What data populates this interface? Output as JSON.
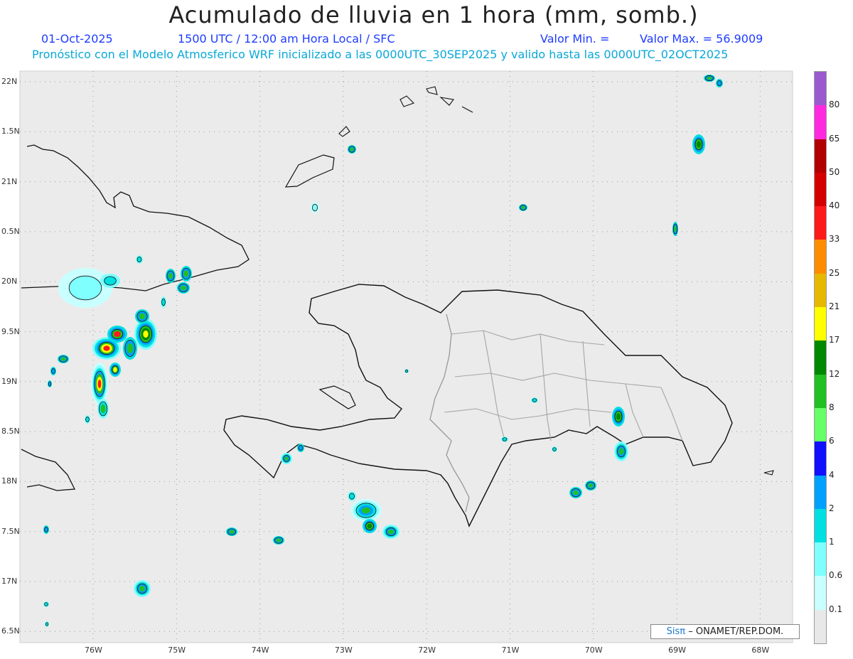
{
  "title": "Acumulado de lluvia en 1 hora (mm, somb.)",
  "header": {
    "date": "01-Oct-2025",
    "time": "1500 UTC / 12:00 am Hora Local / SFC",
    "min": "Valor Min. =",
    "max": "Valor Max. = 56.9009",
    "model": "Pronóstico con el Modelo Atmosferico WRF inicializado a las 0000UTC_30SEP2025 y valido hasta las  0000UTC_02OCT2025"
  },
  "lat_labels": [
    "22N",
    "1.5N",
    "21N",
    "0.5N",
    "20N",
    "9.5N",
    "19N",
    "8.5N",
    "18N",
    "7.5N",
    "17N",
    "6.5N"
  ],
  "lon_labels": [
    "76W",
    "75W",
    "74W",
    "73W",
    "72W",
    "71W",
    "70W",
    "69W",
    "68W"
  ],
  "legend": {
    "labels": [
      "80",
      "65",
      "50",
      "40",
      "33",
      "25",
      "21",
      "17",
      "12",
      "8",
      "6",
      "4",
      "2",
      "1",
      "0.6",
      "0.1"
    ],
    "colors": [
      "#9b59d0",
      "#ff2ae0",
      "#b20000",
      "#d40000",
      "#ff1a1a",
      "#ff8c00",
      "#e6b800",
      "#ffff00",
      "#008800",
      "#22c022",
      "#66ff66",
      "#1010ff",
      "#00a0ff",
      "#00e0e0",
      "#80ffff",
      "#c8ffff",
      "#e8e8e8"
    ]
  },
  "credit": {
    "brand": "Sisπ",
    "text": "– ONAMET/REP.DOM."
  }
}
